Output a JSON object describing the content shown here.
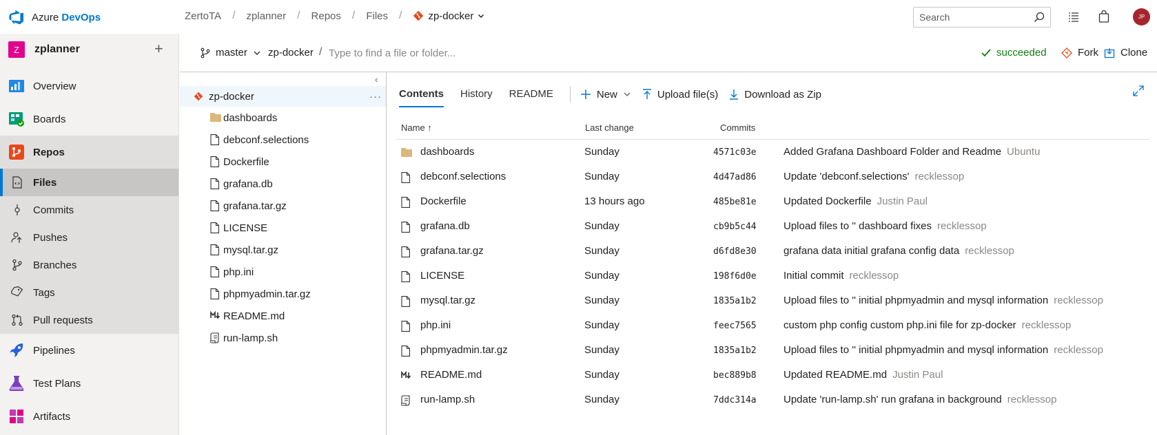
{
  "brand": {
    "name_a": "Azure ",
    "name_b": "DevOps"
  },
  "breadcrumbs": [
    "ZertoTA",
    "zplanner",
    "Repos",
    "Files"
  ],
  "breadcrumb_repo": "zp-docker",
  "search": {
    "placeholder": "Search"
  },
  "avatar": {
    "initials": "JP"
  },
  "project": {
    "badge": "Z",
    "name": "zplanner"
  },
  "nav": {
    "overview": "Overview",
    "boards": "Boards",
    "repos": "Repos",
    "files": "Files",
    "commits": "Commits",
    "pushes": "Pushes",
    "branches": "Branches",
    "tags": "Tags",
    "pull_requests": "Pull requests",
    "pipelines": "Pipelines",
    "test_plans": "Test Plans",
    "artifacts": "Artifacts"
  },
  "repobar": {
    "branch": "master",
    "path_root": "zp-docker",
    "path_sep": "/",
    "path_placeholder": "Type to find a file or folder...",
    "status": "succeeded",
    "fork": "Fork",
    "clone": "Clone"
  },
  "tree": {
    "root": "zp-docker",
    "more": "···",
    "items": [
      {
        "name": "dashboards",
        "kind": "folder"
      },
      {
        "name": "debconf.selections",
        "kind": "file"
      },
      {
        "name": "Dockerfile",
        "kind": "file"
      },
      {
        "name": "grafana.db",
        "kind": "file"
      },
      {
        "name": "grafana.tar.gz",
        "kind": "file"
      },
      {
        "name": "LICENSE",
        "kind": "file"
      },
      {
        "name": "mysql.tar.gz",
        "kind": "file"
      },
      {
        "name": "php.ini",
        "kind": "file"
      },
      {
        "name": "phpmyadmin.tar.gz",
        "kind": "file"
      },
      {
        "name": "README.md",
        "kind": "markdown"
      },
      {
        "name": "run-lamp.sh",
        "kind": "script"
      }
    ]
  },
  "tabs": {
    "contents": "Contents",
    "history": "History",
    "readme": "README"
  },
  "actions": {
    "new": "New",
    "upload": "Upload file(s)",
    "download": "Download as Zip"
  },
  "table": {
    "headers": {
      "name": "Name ↑",
      "last_change": "Last change",
      "commits": "Commits"
    },
    "rows": [
      {
        "name": "dashboards",
        "kind": "folder",
        "date": "Sunday",
        "hash": "4571c03e",
        "message": "Added Grafana Dashboard Folder and Readme",
        "author": "Ubuntu"
      },
      {
        "name": "debconf.selections",
        "kind": "file",
        "date": "Sunday",
        "hash": "4d47ad86",
        "message": "Update 'debconf.selections'",
        "author": "recklessop"
      },
      {
        "name": "Dockerfile",
        "kind": "file",
        "date": "13 hours ago",
        "hash": "485be81e",
        "message": "Updated Dockerfile",
        "author": "Justin Paul"
      },
      {
        "name": "grafana.db",
        "kind": "file",
        "date": "Sunday",
        "hash": "cb9b5c44",
        "message": "Upload files to '' dashboard fixes",
        "author": "recklessop"
      },
      {
        "name": "grafana.tar.gz",
        "kind": "file",
        "date": "Sunday",
        "hash": "d6fd8e30",
        "message": "grafana data initial grafana config data",
        "author": "recklessop"
      },
      {
        "name": "LICENSE",
        "kind": "file",
        "date": "Sunday",
        "hash": "198f6d0e",
        "message": "Initial commit",
        "author": "recklessop"
      },
      {
        "name": "mysql.tar.gz",
        "kind": "file",
        "date": "Sunday",
        "hash": "1835a1b2",
        "message": "Upload files to '' initial phpmyadmin and mysql information",
        "author": "recklessop"
      },
      {
        "name": "php.ini",
        "kind": "file",
        "date": "Sunday",
        "hash": "feec7565",
        "message": "custom php config custom php.ini file for zp-docker",
        "author": "recklessop"
      },
      {
        "name": "phpmyadmin.tar.gz",
        "kind": "file",
        "date": "Sunday",
        "hash": "1835a1b2",
        "message": "Upload files to '' initial phpmyadmin and mysql information",
        "author": "recklessop"
      },
      {
        "name": "README.md",
        "kind": "markdown",
        "date": "Sunday",
        "hash": "bec889b8",
        "message": "Updated README.md",
        "author": "Justin Paul"
      },
      {
        "name": "run-lamp.sh",
        "kind": "script",
        "date": "Sunday",
        "hash": "7ddc314a",
        "message": "Update 'run-lamp.sh' run grafana in background",
        "author": "recklessop"
      }
    ]
  },
  "colors": {
    "accent": "#0078d4",
    "success": "#107c10",
    "project_badge": "#e3008c",
    "avatar": "#a4262c",
    "git": "#e8481c"
  }
}
